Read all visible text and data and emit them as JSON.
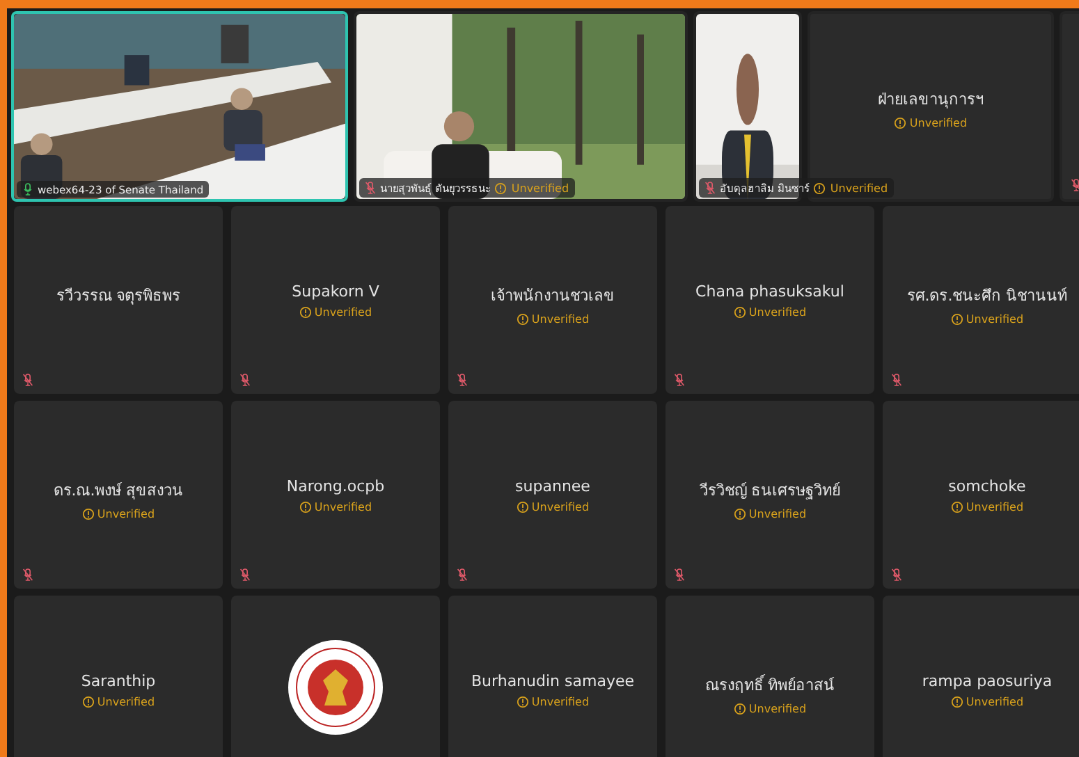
{
  "top_row": [
    {
      "kind": "video",
      "name": "webex64-23 of  Senate Thailand",
      "muted": false,
      "selected": true
    },
    {
      "kind": "video",
      "name": "นายสุวพันธุ์ ตันยุวรรธนะ",
      "muted": true,
      "selected": false,
      "status": "Unverified"
    },
    {
      "kind": "video",
      "name": "อับดุลฮาลิม มินซาร์",
      "muted": true,
      "selected": false,
      "status": "Unverified"
    },
    {
      "kind": "name",
      "name": "ฝ่ายเลขานุการฯ",
      "selected": false,
      "status": "Unverified"
    },
    {
      "kind": "blank",
      "muted": true,
      "selected": false
    }
  ],
  "grid": [
    {
      "kind": "name",
      "name": "รวีวรรณ จตุรพิธพร",
      "muted": true
    },
    {
      "kind": "name",
      "name": "Supakorn V",
      "muted": true,
      "status": "Unverified"
    },
    {
      "kind": "name",
      "name": "เจ้าพนักงานชวเลข",
      "muted": true,
      "status": "Unverified"
    },
    {
      "kind": "name",
      "name": "Chana phasuksakul",
      "muted": true,
      "status": "Unverified"
    },
    {
      "kind": "name",
      "name": "รศ.ดร.ชนะศึก นิชานนท์",
      "muted": true,
      "status": "Unverified"
    },
    {
      "kind": "name",
      "name": "ดร.ณ.พงษ์ สุขสงวน",
      "muted": true,
      "status": "Unverified"
    },
    {
      "kind": "name",
      "name": "Narong.ocpb",
      "muted": true,
      "status": "Unverified"
    },
    {
      "kind": "name",
      "name": "supannee",
      "muted": true,
      "status": "Unverified"
    },
    {
      "kind": "name",
      "name": "วีรวิชญ์  ธนเศรษฐวิทย์",
      "muted": true,
      "status": "Unverified"
    },
    {
      "kind": "name",
      "name": "somchoke",
      "muted": true,
      "status": "Unverified"
    },
    {
      "kind": "name",
      "name": "Saranthip",
      "status": "Unverified"
    },
    {
      "kind": "logo"
    },
    {
      "kind": "name",
      "name": "Burhanudin samayee",
      "status": "Unverified"
    },
    {
      "kind": "name",
      "name": "ณรงฤทธิ์ ทิพย์อาสน์",
      "status": "Unverified"
    },
    {
      "kind": "name",
      "name": "rampa paosuriya",
      "status": "Unverified"
    }
  ]
}
